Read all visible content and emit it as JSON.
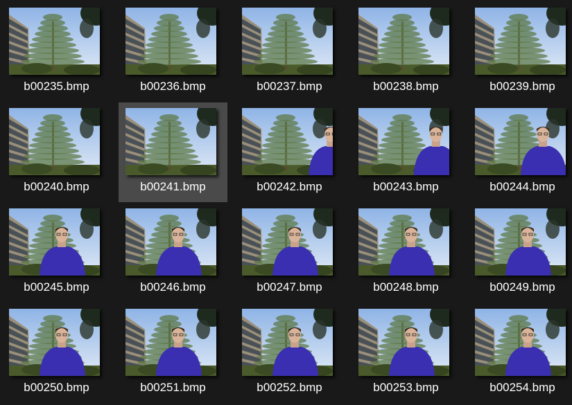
{
  "view": {
    "selected_index": 6
  },
  "files": [
    {
      "name": "b00235.bmp",
      "person": 0
    },
    {
      "name": "b00236.bmp",
      "person": 0
    },
    {
      "name": "b00237.bmp",
      "person": 0
    },
    {
      "name": "b00238.bmp",
      "person": 0
    },
    {
      "name": "b00239.bmp",
      "person": 0
    },
    {
      "name": "b00240.bmp",
      "person": 0
    },
    {
      "name": "b00241.bmp",
      "person": 0
    },
    {
      "name": "b00242.bmp",
      "person": 0.05
    },
    {
      "name": "b00243.bmp",
      "person": 0.35
    },
    {
      "name": "b00244.bmp",
      "person": 0.6
    },
    {
      "name": "b00245.bmp",
      "person": 1
    },
    {
      "name": "b00246.bmp",
      "person": 1
    },
    {
      "name": "b00247.bmp",
      "person": 1
    },
    {
      "name": "b00248.bmp",
      "person": 1
    },
    {
      "name": "b00249.bmp",
      "person": 1
    },
    {
      "name": "b00250.bmp",
      "person": 1
    },
    {
      "name": "b00251.bmp",
      "person": 1
    },
    {
      "name": "b00252.bmp",
      "person": 1
    },
    {
      "name": "b00253.bmp",
      "person": 1
    },
    {
      "name": "b00254.bmp",
      "person": 1
    }
  ]
}
